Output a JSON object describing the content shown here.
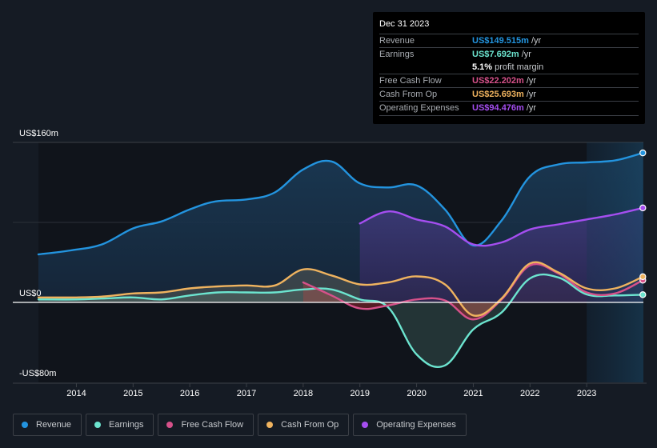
{
  "tooltip": {
    "date": "Dec 31 2023",
    "rows": [
      {
        "label": "Revenue",
        "value": "US$149.515m",
        "unit": "/yr",
        "color": "#2394df"
      },
      {
        "label": "Earnings",
        "value": "US$7.692m",
        "unit": "/yr",
        "color": "#6ce4cf"
      },
      {
        "label": "",
        "value": "5.1%",
        "unit": "profit margin",
        "color": "#ffffff"
      },
      {
        "label": "Free Cash Flow",
        "value": "US$22.202m",
        "unit": "/yr",
        "color": "#d6518a"
      },
      {
        "label": "Cash From Op",
        "value": "US$25.693m",
        "unit": "/yr",
        "color": "#efb35f"
      },
      {
        "label": "Operating Expenses",
        "value": "US$94.476m",
        "unit": "/yr",
        "color": "#a54ef0"
      }
    ]
  },
  "legend": [
    {
      "label": "Revenue",
      "color": "#2394df"
    },
    {
      "label": "Earnings",
      "color": "#6ce4cf"
    },
    {
      "label": "Free Cash Flow",
      "color": "#d6518a"
    },
    {
      "label": "Cash From Op",
      "color": "#efb35f"
    },
    {
      "label": "Operating Expenses",
      "color": "#a54ef0"
    }
  ],
  "chart_data": {
    "type": "area",
    "title": "",
    "xlabel": "",
    "ylabel": "",
    "xlim": [
      2013.33,
      2024.0
    ],
    "ylim": [
      -80,
      160
    ],
    "y_ticks": [
      {
        "value": 160,
        "label": "US$160m"
      },
      {
        "value": 0,
        "label": "US$0"
      },
      {
        "value": -80,
        "label": "-US$80m"
      }
    ],
    "x_ticks": [
      2014,
      2015,
      2016,
      2017,
      2018,
      2019,
      2020,
      2021,
      2022,
      2023
    ],
    "grid": true,
    "highlight_region": [
      2023.0,
      2024.0
    ],
    "legend_position": "bottom-left",
    "series": [
      {
        "name": "Revenue",
        "color": "#2394df",
        "x": [
          2013.33,
          2013.9,
          2014.45,
          2015.0,
          2015.5,
          2016.0,
          2016.45,
          2017.0,
          2017.5,
          2018.0,
          2018.5,
          2019.0,
          2019.5,
          2020.0,
          2020.5,
          2021.0,
          2021.5,
          2022.0,
          2022.5,
          2023.0,
          2023.5,
          2023.99
        ],
        "values": [
          48,
          52,
          58,
          74,
          81,
          93,
          101,
          103,
          110,
          133,
          141,
          119,
          115,
          117,
          93,
          57,
          82,
          126,
          138,
          140,
          142,
          149.5
        ]
      },
      {
        "name": "Earnings",
        "color": "#6ce4cf",
        "x": [
          2013.33,
          2014.0,
          2014.5,
          2015.0,
          2015.5,
          2016.0,
          2016.5,
          2017.0,
          2017.5,
          2018.0,
          2018.5,
          2019.0,
          2019.5,
          2020.0,
          2020.5,
          2021.0,
          2021.5,
          2022.0,
          2022.5,
          2023.0,
          2023.5,
          2023.99
        ],
        "values": [
          3,
          3,
          4,
          5,
          3,
          7,
          10,
          10,
          10,
          13,
          13,
          3,
          -5,
          -52,
          -63,
          -27,
          -10,
          24,
          25,
          8,
          7,
          7.7
        ]
      },
      {
        "name": "Free Cash Flow",
        "color": "#d6518a",
        "x": [
          2018.0,
          2018.5,
          2019.0,
          2019.5,
          2020.0,
          2020.5,
          2021.0,
          2021.5,
          2022.0,
          2022.5,
          2023.0,
          2023.5,
          2023.99
        ],
        "values": [
          20,
          7,
          -6,
          -3,
          3,
          2,
          -17,
          3,
          37,
          29,
          10,
          9,
          22.2
        ]
      },
      {
        "name": "Cash From Op",
        "color": "#efb35f",
        "x": [
          2013.33,
          2014.0,
          2014.5,
          2015.0,
          2015.5,
          2016.0,
          2016.5,
          2017.0,
          2017.5,
          2018.0,
          2018.5,
          2019.0,
          2019.5,
          2020.0,
          2020.5,
          2021.0,
          2021.5,
          2022.0,
          2022.5,
          2023.0,
          2023.5,
          2023.99
        ],
        "values": [
          5,
          5,
          6,
          9,
          10,
          14,
          16,
          17,
          17,
          33,
          27,
          18,
          20,
          26,
          18,
          -13,
          4,
          39,
          30,
          14,
          14,
          25.7
        ]
      },
      {
        "name": "Operating Expenses",
        "color": "#a54ef0",
        "x": [
          2019.0,
          2019.5,
          2020.0,
          2020.5,
          2021.0,
          2021.5,
          2022.0,
          2022.5,
          2023.0,
          2023.5,
          2023.99
        ],
        "values": [
          79,
          91,
          83,
          76,
          58,
          60,
          73,
          78,
          83,
          88,
          94.5
        ]
      }
    ]
  }
}
